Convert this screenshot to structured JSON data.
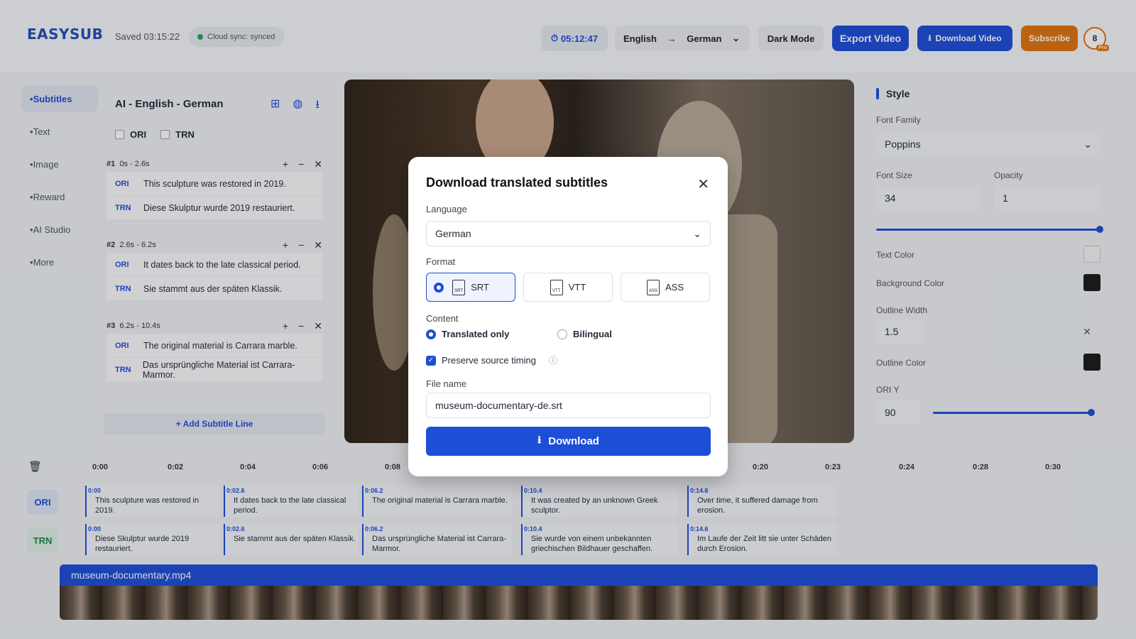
{
  "header": {
    "logo": "EASYSUB",
    "saved": "Saved 03:15:22",
    "sync": "Cloud sync: synced",
    "timer": "05:12:47",
    "lang_from": "English",
    "lang_to": "German",
    "dark_mode": "Dark Mode",
    "export": "Export Video",
    "download_video": "Download Video",
    "subscribe": "Subscribe",
    "avatar": "8",
    "pro": "Pro"
  },
  "nav": [
    "Subtitles",
    "Text",
    "Image",
    "Reward",
    "AI Studio",
    "More"
  ],
  "editor": {
    "title": "AI - English - German",
    "ori": "ORI",
    "trn": "TRN",
    "add": "+ Add Subtitle Line",
    "blocks": [
      {
        "id": "#1",
        "time": "0s - 2.6s",
        "ori": "This sculpture was restored in 2019.",
        "trn": "Diese Skulptur wurde 2019 restauriert."
      },
      {
        "id": "#2",
        "time": "2.6s - 6.2s",
        "ori": "It dates back to the late classical period.",
        "trn": "Sie stammt aus der späten Klassik."
      },
      {
        "id": "#3",
        "time": "6.2s - 10.4s",
        "ori": "The original material is Carrara marble.",
        "trn": "Das ursprüngliche Material ist Carrara-Marmor."
      }
    ]
  },
  "style": {
    "title": "Style",
    "font_family_label": "Font Family",
    "font_family": "Poppins",
    "font_size_label": "Font Size",
    "font_size": "34",
    "opacity_label": "Opacity",
    "opacity": "1",
    "opacity_level": 1.0,
    "text_color_label": "Text Color",
    "text_color": "#f5f5f5",
    "bg_color_label": "Background Color",
    "bg_color": "#1a1a1a",
    "outline_width_label": "Outline Width",
    "outline_width": "1.5",
    "outline_color_label": "Outline Color",
    "outline_color": "#1a1a1a",
    "ori_y_label": "ORI Y",
    "ori_y": "90"
  },
  "modal": {
    "title": "Download translated subtitles",
    "language_label": "Language",
    "language": "German",
    "format_label": "Format",
    "formats": [
      "SRT",
      "VTT",
      "ASS"
    ],
    "content_label": "Content",
    "translated": "Translated only",
    "bilingual": "Bilingual",
    "preserve": "Preserve source timing",
    "filename_label": "File name",
    "filename": "museum-documentary-de.srt",
    "download": "Download"
  },
  "timeline": {
    "ticks": [
      "0:00",
      "0:02",
      "0:04",
      "0:06",
      "0:08",
      "0:20",
      "0:23",
      "0:24",
      "0:28",
      "0:30"
    ],
    "ori_label": "ORI",
    "trn_label": "TRN",
    "ori": [
      {
        "t": "0:00",
        "text": "This sculpture was restored in 2019."
      },
      {
        "t": "0:02.6",
        "text": "It dates back to the late classical period."
      },
      {
        "t": "0:06.2",
        "text": "The original material is Carrara marble."
      },
      {
        "t": "0:10.4",
        "text": "It was created by an unknown Greek sculptor."
      },
      {
        "t": "0:14.6",
        "text": "Over time, it suffered damage from erosion."
      }
    ],
    "trn": [
      {
        "t": "0:00",
        "text": "Diese Skulptur wurde 2019 restauriert."
      },
      {
        "t": "0:02.6",
        "text": "Sie stammt aus der späten Klassik."
      },
      {
        "t": "0:06.2",
        "text": "Das ursprüngliche Material ist Carrara-Marmor."
      },
      {
        "t": "0:10.4",
        "text": "Sie wurde von einem unbekannten griechischen Bildhauer geschaffen."
      },
      {
        "t": "0:14.6",
        "text": "Im Laufe der Zeit litt sie unter Schäden durch Erosion."
      }
    ],
    "file": "museum-documentary.mp4"
  }
}
